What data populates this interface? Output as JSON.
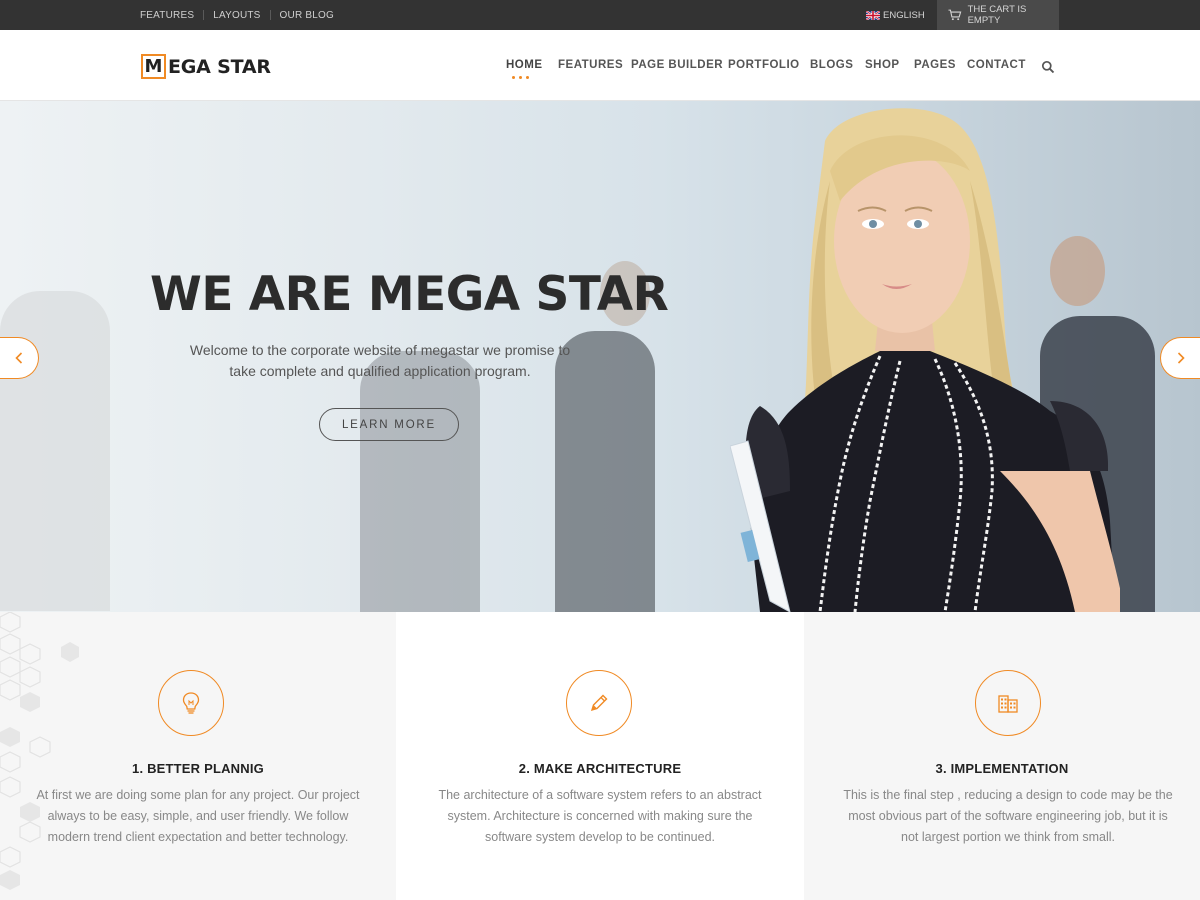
{
  "topbar": {
    "links": [
      "FEATURES",
      "LAYOUTS",
      "OUR BLOG"
    ],
    "language": "ENGLISH",
    "cart": "THE CART IS EMPTY"
  },
  "header": {
    "logo_mark": "M",
    "logo_text": "EGA STAR",
    "nav": [
      "HOME",
      "FEATURES",
      "PAGE BUILDER",
      "PORTFOLIO",
      "BLOGS",
      "SHOP",
      "PAGES",
      "CONTACT"
    ],
    "active_nav": "HOME"
  },
  "hero": {
    "title": "WE ARE MEGA STAR",
    "subtitle_line1": "Welcome to the corporate website of megastar we promise to",
    "subtitle_line2": "take complete and qualified application program.",
    "button": "LEARN MORE",
    "prev_arrow": "‹",
    "next_arrow": "›"
  },
  "features": [
    {
      "title": "1. BETTER PLANNIG",
      "icon": "lightbulb-icon",
      "lines": [
        "At first we are doing some plan for any project. Our project",
        "always to be easy, simple, and user friendly. We follow",
        "modern trend client expectation and better technology."
      ]
    },
    {
      "title": "2. MAKE ARCHITECTURE",
      "icon": "pencil-icon",
      "lines": [
        "The architecture of a software system refers to an abstract",
        "system. Architecture is concerned with making sure the",
        "software system develop to be continued."
      ]
    },
    {
      "title": "3. IMPLEMENTATION",
      "icon": "building-icon",
      "lines": [
        "This is the final step , reducing a design to code may be the",
        "most obvious part of the software engineering job, but it is",
        "not largest portion we think from small."
      ]
    }
  ],
  "colors": {
    "accent": "#f08a24",
    "topbar_bg": "#333333",
    "cart_bg": "#4a4a4a"
  }
}
